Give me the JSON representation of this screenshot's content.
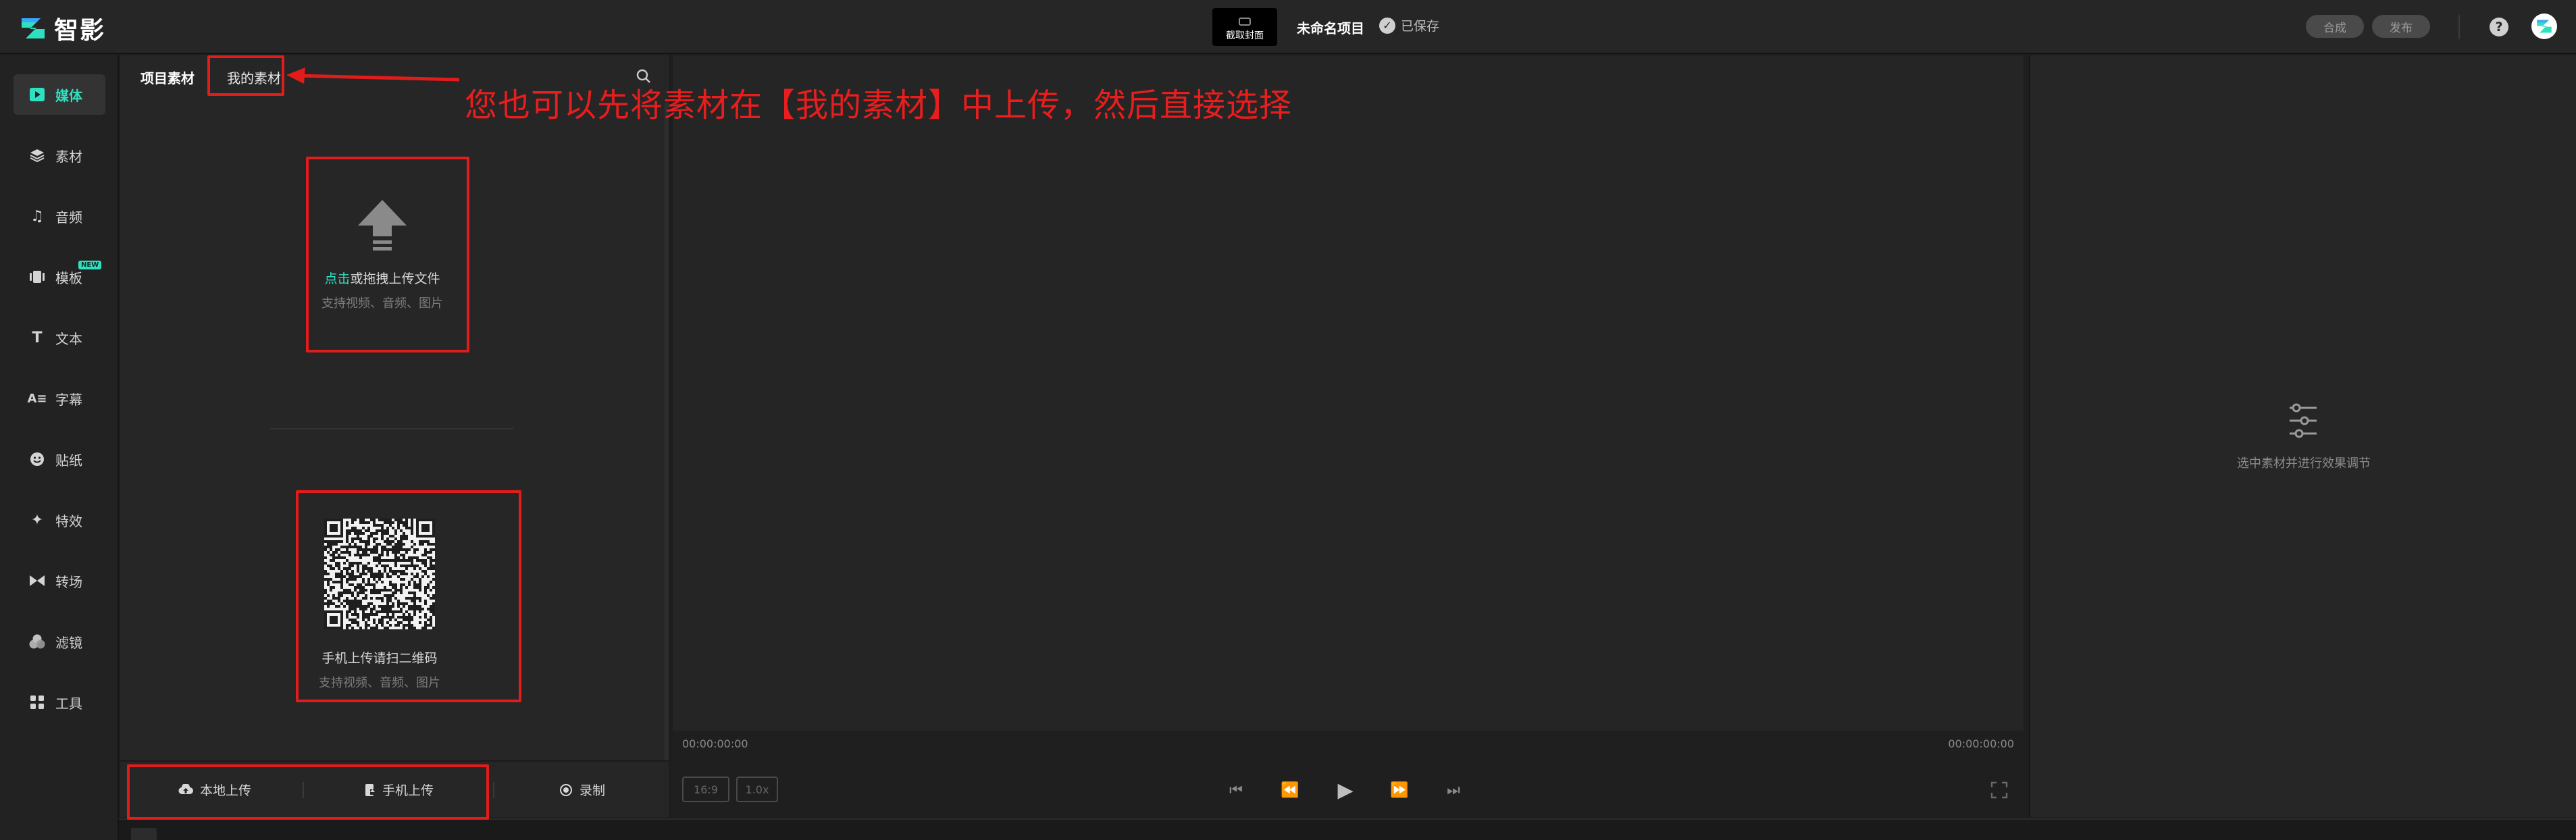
{
  "app": {
    "name": "智影"
  },
  "header": {
    "cover_label": "截取封面",
    "project_name": "未命名项目",
    "saved_text": "已保存",
    "export_label": "合成",
    "publish_label": "发布",
    "help_symbol": "?"
  },
  "nav": {
    "items": [
      {
        "label": "媒体",
        "icon": "media-icon"
      },
      {
        "label": "素材",
        "icon": "layers-icon"
      },
      {
        "label": "音频",
        "icon": "music-icon"
      },
      {
        "label": "模板",
        "icon": "template-icon",
        "badge": "NEW"
      },
      {
        "label": "文本",
        "icon": "text-icon"
      },
      {
        "label": "字幕",
        "icon": "subtitle-icon"
      },
      {
        "label": "贴纸",
        "icon": "sticker-icon"
      },
      {
        "label": "特效",
        "icon": "effects-icon"
      },
      {
        "label": "转场",
        "icon": "transition-icon"
      },
      {
        "label": "滤镜",
        "icon": "filter-icon"
      },
      {
        "label": "工具",
        "icon": "tools-icon"
      }
    ]
  },
  "media": {
    "tabs": {
      "project": "项目素材",
      "mine": "我的素材"
    },
    "upload": {
      "click": "点击",
      "rest": "或拖拽上传文件",
      "hint": "支持视频、音频、图片"
    },
    "qr": {
      "title": "手机上传请扫二维码",
      "hint": "支持视频、音频、图片"
    },
    "bottom": {
      "local": "本地上传",
      "phone": "手机上传",
      "record": "录制"
    }
  },
  "player": {
    "time_current": "00:00:00:00",
    "time_total": "00:00:00:00",
    "ratio": "16:9",
    "speed": "1.0x"
  },
  "right_panel": {
    "hint": "选中素材并进行效果调节"
  },
  "annotation": {
    "text": "您也可以先将素材在【我的素材】中上传，然后直接选择"
  },
  "colors": {
    "accent": "#2fe0c0",
    "annotation": "#e21b1b"
  }
}
